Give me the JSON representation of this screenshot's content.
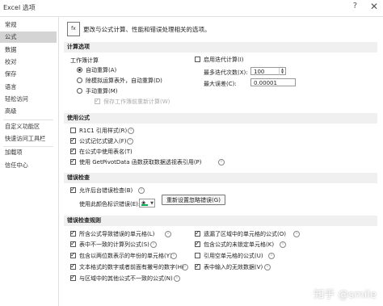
{
  "window": {
    "title": "Excel 选项",
    "help_glyph": "?",
    "close_glyph": "✕"
  },
  "sidebar": {
    "items": [
      {
        "label": "常规"
      },
      {
        "label": "公式",
        "selected": true
      },
      {
        "label": "数据"
      },
      {
        "label": "校对"
      },
      {
        "label": "保存"
      },
      {
        "label": "语言"
      },
      {
        "label": "轻松访问"
      },
      {
        "label": "高级"
      },
      {
        "label": "自定义功能区"
      },
      {
        "label": "快速访问工具栏"
      },
      {
        "label": "加载项"
      },
      {
        "label": "信任中心"
      }
    ]
  },
  "intro": {
    "icon_text": "fx",
    "text": "更改与公式计算、性能和错误处理相关的选项。"
  },
  "calc": {
    "header": "计算选项",
    "workbook_label": "工作簿计算",
    "radios": [
      {
        "label": "自动重算(A)",
        "checked": true
      },
      {
        "label": "除模拟运算表外，自动重算(D)",
        "checked": false
      },
      {
        "label": "手动重算(M)",
        "checked": false
      }
    ],
    "recalc_before_save": {
      "label": "保存工作簿前重新计算(W)",
      "checked": true,
      "disabled": true
    },
    "iterative": {
      "label": "启用迭代计算(I)",
      "checked": false
    },
    "max_iter": {
      "label": "最多迭代次数(X):",
      "value": "100"
    },
    "max_change": {
      "label": "最大误差(C):",
      "value": "0.00001"
    }
  },
  "formulas": {
    "header": "使用公式",
    "items": [
      {
        "label": "R1C1 引用样式(R)",
        "checked": false
      },
      {
        "label": "公式记忆式键入(F)",
        "checked": true
      },
      {
        "label": "在公式中使用表名(T)",
        "checked": true
      },
      {
        "label": "使用 GetPivotData 函数获取数据透视表引用(P)",
        "checked": true
      }
    ]
  },
  "errcheck": {
    "header": "错误检查",
    "enable": {
      "label": "允许后台错误检查(B)",
      "checked": true
    },
    "color_label": "使用此颜色标识错误(E):",
    "color": "#00b050",
    "reset_button": "重新设置忽略错误(G)"
  },
  "rules": {
    "header": "错误检查规则",
    "left": [
      {
        "label": "所含公式导致错误的单元格(L)",
        "checked": true
      },
      {
        "label": "表中不一致的计算列公式(S)",
        "checked": true
      },
      {
        "label": "包含以两位数表示的年份的单元格(Y)",
        "checked": true
      },
      {
        "label": "文本格式的数字或者前面有撇号的数字(H)",
        "checked": true
      },
      {
        "label": "与区域中的其他公式不一致的公式(N)",
        "checked": true
      }
    ],
    "right": [
      {
        "label": "遗漏了区域中的单元格的公式(O)",
        "checked": true
      },
      {
        "label": "包含公式的未锁定单元格(K)",
        "checked": true
      },
      {
        "label": "引用空单元格的公式(U)",
        "checked": false
      },
      {
        "label": "表中输入的无效数据(V)",
        "checked": true
      }
    ]
  },
  "watermark": "知乎 @smile"
}
